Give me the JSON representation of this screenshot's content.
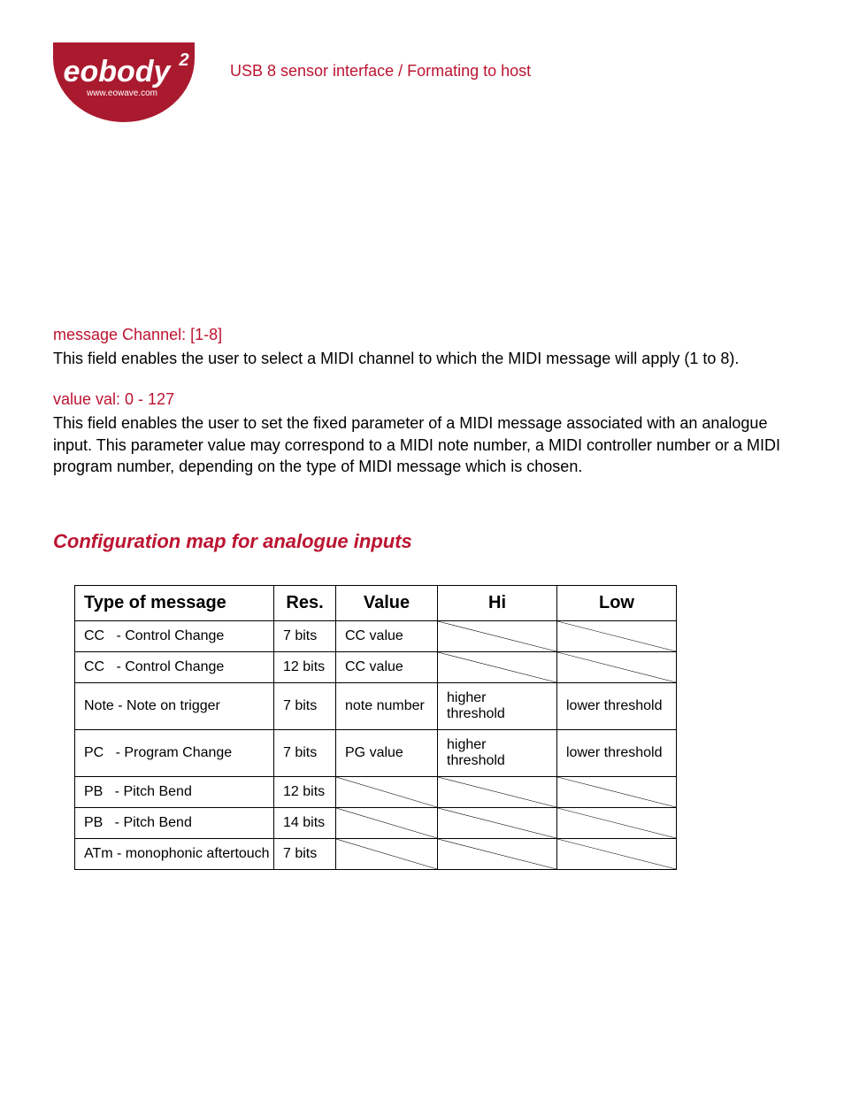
{
  "header": {
    "logo": {
      "line1": "eobody",
      "exponent": "2",
      "subline": "www.eowave.com",
      "bg": "#aa1a2e",
      "fg": "#ffffff"
    },
    "title": "USB 8 sensor interface / Formating to host"
  },
  "accent_color": "#bc1431",
  "sections": {
    "channel": {
      "label": "message Channel: [1-8]",
      "text": "This field enables the user to select a MIDI channel to which the MIDI message will apply (1 to 8)."
    },
    "value": {
      "label": "value val: 0 - 127",
      "text": "This field enables the user to set the fixed parameter of a MIDI message associated with an analogue input. This parameter value may correspond to a MIDI note number, a MIDI controller number or a MIDI program number, depending on the type of MIDI message which is chosen."
    }
  },
  "table_heading": "Configuration map for analogue inputs",
  "table": {
    "headers": {
      "type": "Type of message",
      "res": "Res.",
      "value": "Value",
      "hi": "Hi",
      "low": "Low"
    },
    "rows": [
      {
        "type": "CC   - Control Change",
        "res": "7 bits",
        "value": "CC value",
        "hi": null,
        "low": null
      },
      {
        "type": "CC   - Control Change",
        "res": "12 bits",
        "value": "CC value",
        "hi": null,
        "low": null
      },
      {
        "type": "Note - Note on trigger",
        "res": "7 bits",
        "value": "note number",
        "hi": "higher threshold",
        "low": "lower threshold"
      },
      {
        "type": "PC   - Program Change",
        "res": "7 bits",
        "value": "PG value",
        "hi": "higher threshold",
        "low": "lower threshold"
      },
      {
        "type": "PB   - Pitch Bend",
        "res": "12 bits",
        "value": null,
        "hi": null,
        "low": null
      },
      {
        "type": "PB   - Pitch Bend",
        "res": "14 bits",
        "value": null,
        "hi": null,
        "low": null
      },
      {
        "type": "ATm - monophonic aftertouch",
        "res": "7 bits",
        "value": null,
        "hi": null,
        "low": null
      }
    ]
  }
}
